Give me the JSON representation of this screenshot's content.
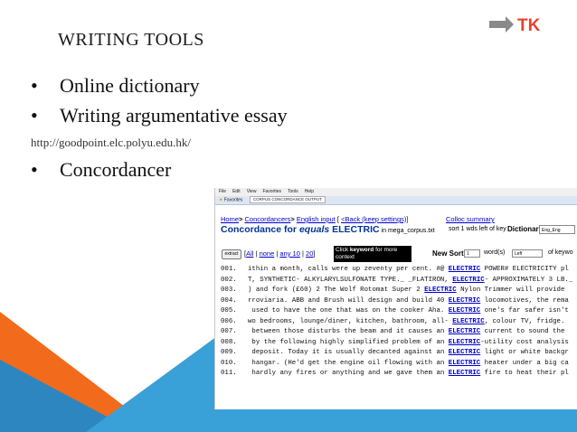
{
  "slide": {
    "title": "WRITING TOOLS",
    "logo_text": "TK",
    "bullets": [
      "Online dictionary",
      "Writing argumentative essay"
    ],
    "url": "http://goodpoint.elc.polyu.edu.hk/",
    "bullet3": "Concordancer",
    "bullet_glyph": "•"
  },
  "colors": {
    "orange": "#f26a1b",
    "blue": "#3aa0d8",
    "logo_red": "#e8402a",
    "link_blue": "#0000cc",
    "heading_blue": "#003399"
  },
  "browser": {
    "menu": [
      "File",
      "Edit",
      "View",
      "Favorites",
      "Tools",
      "Help"
    ],
    "favorites_label": "Favorites",
    "tab_title": "CORPUS CONCORDANCE OUTPUT"
  },
  "concordance": {
    "nav": {
      "home": "Home",
      "concordancers": "Concordancers",
      "english_input": "English input",
      "back": "<Back (keep settings)]",
      "sep": ">",
      "bracket": " [ "
    },
    "colloc": "Colloc summary",
    "heading": {
      "prefix": "Concordance for ",
      "equals": "equals",
      "keyword": " ELECTRIC",
      "in": " in mega_corpus.txt"
    },
    "sort_info": "sort 1 wds left of key",
    "dictionary_label": "Dictionary",
    "dictionary_value": "Eng_Eng",
    "extract_button": "extract",
    "selection": {
      "open": "[",
      "all": "All",
      "none": "none",
      "any10": "any 10",
      "twenty": "20",
      "close": "]",
      "sep": " | "
    },
    "click_hint": {
      "pre": "Click ",
      "kw": "keyword",
      "post": " for more context"
    },
    "new_sort": "New Sort:",
    "sort_num": "1",
    "words_label": "word(s)",
    "sort_dir": "Left",
    "of_key": "of keywo",
    "lines": [
      {
        "n": "001.",
        "pre": "ithin a month, calls were up zeventy per cent. #@ ",
        "kw": "ELECTRIC",
        "post": " POWER# ELECTRICITY pl"
      },
      {
        "n": "002.",
        "pre": "T, SYNTHETIC- ALKYLARYLSULFONATE TYPE._ _FLATIRON, ",
        "kw": "ELECTRIC",
        "post": "- APPROXIMATELY 3 LB._"
      },
      {
        "n": "003.",
        "pre": ") and fork (£60) 2 The Wolf Rotomat Super 2 ",
        "kw": "ELECTRIC",
        "post": " Nylon Trimmer will provide"
      },
      {
        "n": "004.",
        "pre": "rroviaria. ABB and Brush will design and build 40 ",
        "kw": "ELECTRIC",
        "post": " locomotives, the rema"
      },
      {
        "n": "005.",
        "pre": " used to have the one that was on the cooker Aha. ",
        "kw": "ELECTRIC",
        "post": " one's far safer isn't"
      },
      {
        "n": "006.",
        "pre": "wo bedrooms, lounge/diner, kitchen, bathroom, all- ",
        "kw": "ELECTRIC",
        "post": ", colour TV, fridge."
      },
      {
        "n": "007.",
        "pre": " between those disturbs the beam and it causes an ",
        "kw": "ELECTRIC",
        "post": " current to sound the"
      },
      {
        "n": "008.",
        "pre": " by the following highly simplified problem of an ",
        "kw": "ELECTRIC",
        "post": "-utility cost analysis"
      },
      {
        "n": "009.",
        "pre": " deposit. Today it is usually decanted against an ",
        "kw": "ELECTRIC",
        "post": " light or white backgr"
      },
      {
        "n": "010.",
        "pre": " hangar. (He'd get the engine oil flowing with an ",
        "kw": "ELECTRIC",
        "post": " heater under a big ca"
      },
      {
        "n": "011.",
        "pre": " hardly any fires or anything and we gave them an ",
        "kw": "ELECTRIC",
        "post": " fire to heat their pl"
      }
    ]
  }
}
